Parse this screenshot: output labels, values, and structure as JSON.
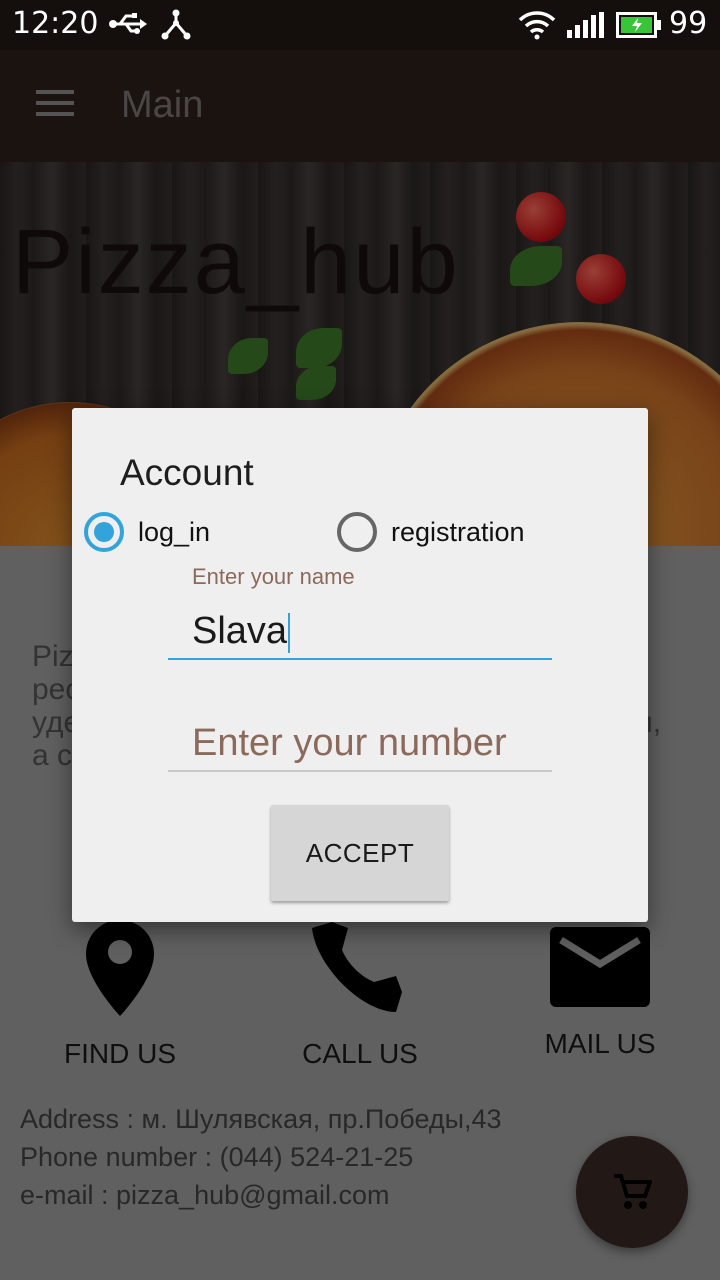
{
  "status_bar": {
    "time": "12:20",
    "battery_level": "99",
    "icons": [
      "usb-icon",
      "tether-icon",
      "wifi-icon",
      "signal-icon",
      "battery-icon"
    ]
  },
  "app_bar": {
    "title": "Main",
    "menu_icon": "hamburger-menu-icon"
  },
  "hero": {
    "brand": "Pizza_hub"
  },
  "main": {
    "description_lines": [
      "Piz",
      "рес",
      "уде",
      "а с"
    ],
    "description_right_fragment": "и,",
    "contacts": [
      {
        "label": "FIND US",
        "icon": "location-pin-icon"
      },
      {
        "label": "CALL US",
        "icon": "phone-icon"
      },
      {
        "label": "MAIL US",
        "icon": "mail-icon"
      }
    ],
    "address": "Address : м. Шулявская, пр.Победы,43",
    "phone": "Phone number : (044) 524-21-25",
    "email": "e-mail : pizza_hub@gmail.com",
    "fab_icon": "cart-icon"
  },
  "dialog": {
    "title": "Account",
    "radio_options": [
      {
        "label": "log_in",
        "checked": true
      },
      {
        "label": "registration",
        "checked": false
      }
    ],
    "name_label": "Enter your name",
    "name_value": "Slava",
    "number_placeholder": "Enter your number",
    "accept_label": "ACCEPT"
  },
  "colors": {
    "accent": "#33a3dc",
    "app_bar": "#2d201c",
    "status_bar": "#140e0c",
    "hint": "#8b6a5c"
  }
}
